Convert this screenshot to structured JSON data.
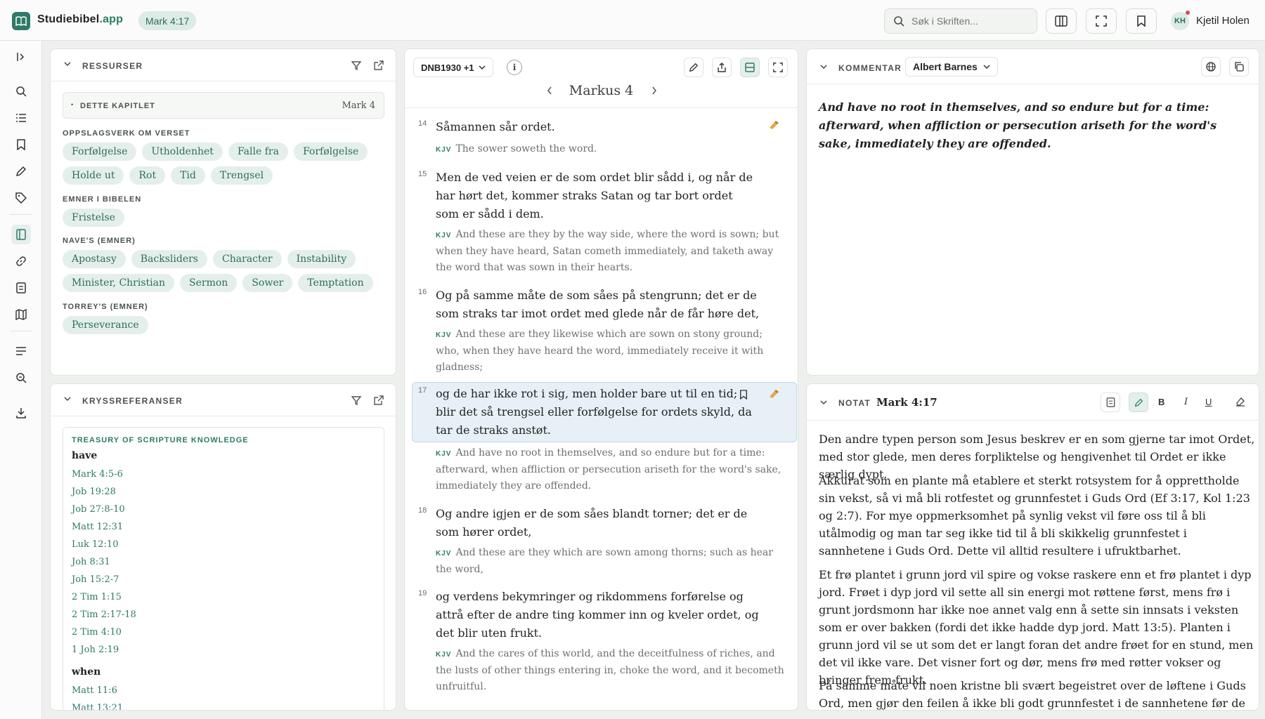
{
  "topbar": {
    "brand": "Studiebibel",
    "brand_suffix": ".app",
    "ref": "Mark 4:17",
    "search_placeholder": "Søk i Skriften...",
    "avatar_initials": "KH",
    "username": "Kjetil Holen"
  },
  "rail": {
    "icons": [
      "expand-sidebar-icon",
      "search-icon",
      "list-icon",
      "bookmark-icon",
      "pen-icon",
      "tag-icon",
      "book-icon",
      "link-icon",
      "notes-icon",
      "map-icon",
      "lines-icon",
      "zoom-icon",
      "download-icon"
    ]
  },
  "resources": {
    "title": "RESSURSER",
    "chapter_label": "DETTE KAPITLET",
    "chapter_ref": "Mark 4",
    "sections": [
      {
        "label": "OPPSLAGSVERK OM VERSET",
        "rows": [
          [
            "Forfølgelse",
            "Utholdenhet",
            "Falle fra",
            "Forfølgelse"
          ],
          [
            "Holde ut",
            "Rot",
            "Tid",
            "Trengsel"
          ]
        ]
      },
      {
        "label": "EMNER I BIBELEN",
        "rows": [
          [
            "Fristelse"
          ]
        ]
      },
      {
        "label": "NAVE'S (EMNER)",
        "rows": [
          [
            "Apostasy",
            "Backsliders",
            "Character",
            "Instability"
          ],
          [
            "Minister, Christian",
            "Sermon",
            "Sower",
            "Temptation"
          ]
        ]
      },
      {
        "label": "TORREY'S (EMNER)",
        "rows": [
          [
            "Perseverance"
          ]
        ]
      }
    ]
  },
  "crossrefs": {
    "title": "KRYSSREFERANSER",
    "source": "TREASURY OF SCRIPTURE KNOWLEDGE",
    "groups": [
      {
        "word": "have",
        "refs": [
          "Mark 4:5-6",
          "Job 19:28",
          "Job 27:8-10",
          "Matt 12:31",
          "Luk 12:10",
          "Joh 8:31",
          "Joh 15:2-7",
          "2 Tim 1:15",
          "2 Tim 2:17-18",
          "2 Tim 4:10",
          "1 Joh 2:19"
        ]
      },
      {
        "word": "when",
        "refs": [
          "Matt 11:6",
          "Matt 13:21"
        ]
      }
    ]
  },
  "bible": {
    "translation": "DNB1930 +1",
    "chapter_title": "Markus 4",
    "kjv_tag": "KJV",
    "verses": [
      {
        "num": "14",
        "lines": [
          "Såmannen sår ordet."
        ],
        "kjv": "The sower soweth the word."
      },
      {
        "num": "15",
        "lines": [
          "Men de ved veien er de som ordet blir sådd i, og når de",
          "har hørt det, kommer straks Satan og tar bort ordet",
          "som er sådd i dem."
        ],
        "kjv": "And these are they by the way side, where the word is sown; but when they have heard, Satan cometh immediately, and taketh away the word that was sown in their hearts."
      },
      {
        "num": "16",
        "lines": [
          "Og på samme måte de som såes på stengrunn; det er de",
          "som straks tar imot ordet med glede når de får høre det,"
        ],
        "kjv": "And these are they likewise which are sown on stony ground; who, when they have heard the word, immediately receive it with gladness;"
      },
      {
        "num": "17",
        "lines": [
          "og de har ikke rot i sig, men holder bare ut til en tid;",
          "blir det så trengsel eller forfølgelse for ordets skyld, da",
          "tar de straks anstøt."
        ],
        "kjv": "And have no root in themselves, and so endure but for a time: afterward, when affliction or persecution ariseth for the word's sake, immediately they are offended."
      },
      {
        "num": "18",
        "lines": [
          "Og andre igjen er de som såes blandt torner; det er de",
          "som hører ordet,"
        ],
        "kjv": "And these are they which are sown among thorns; such as hear the word,"
      },
      {
        "num": "19",
        "lines": [
          "og verdens bekymringer og rikdommens forførelse og",
          "attrå efter de andre ting kommer inn og kveler ordet, og",
          "det blir uten frukt."
        ],
        "kjv": "And the cares of this world, and the deceitfulness of riches, and the lusts of other things entering in, choke the word, and it becometh unfruitful."
      }
    ]
  },
  "commentary": {
    "title": "KOMMENTAR",
    "author": "Albert Barnes",
    "text": "And have no root in themselves, and so endure but for a time: afterward, when affliction or persecution ariseth for the word's sake, immediately they are offended."
  },
  "note": {
    "title": "NOTAT",
    "ref": "Mark 4:17",
    "bold_label": "B",
    "italic_label": "I",
    "underline_label": "U",
    "paragraphs": [
      "Den andre typen person som Jesus beskrev er en som gjerne tar imot Ordet, med stor glede, men deres forpliktelse og hengivenhet til Ordet er ikke særlig dypt.",
      "Akkurat som en plante må etablere et sterkt rotsystem for å opprettholde sin vekst, så vi må bli rotfestet og grunnfestet i Guds Ord (Ef 3:17, Kol 1:23 og 2:7). For mye oppmerksomhet på synlig vekst vil føre oss til å bli utålmodig og man tar seg ikke tid til å bli skikkelig grunnfestet i sannhetene i Guds Ord. Dette vil alltid resultere i ufruktbarhet.",
      "Et frø plantet i grunn jord vil spire og vokse raskere enn et frø plantet i dyp jord. Frøet i dyp jord vil sette all sin energi mot røttene først, mens frø i grunt jordsmonn har ikke noe annet valg enn å sette sin innsats i veksten som er over bakken (fordi det ikke hadde dyp jord. Matt 13:5). Planten i grunn jord vil se ut som det er langt foran det andre frøet for en stund, men det vil ikke vare. Det visner fort og dør, mens frø med røtter vokser og bringer frem frukt.",
      "På samme måte vil noen kristne bli svært begeistret over de løftene i Guds Ord, men gjør den feilen å ikke bli godt grunnfestet i de sannhetene før de \"hopper ut"
    ]
  },
  "colors": {
    "accent": "#2e7a68",
    "chip_bg": "#e4efeb",
    "highlight": "#e7f0f7"
  }
}
